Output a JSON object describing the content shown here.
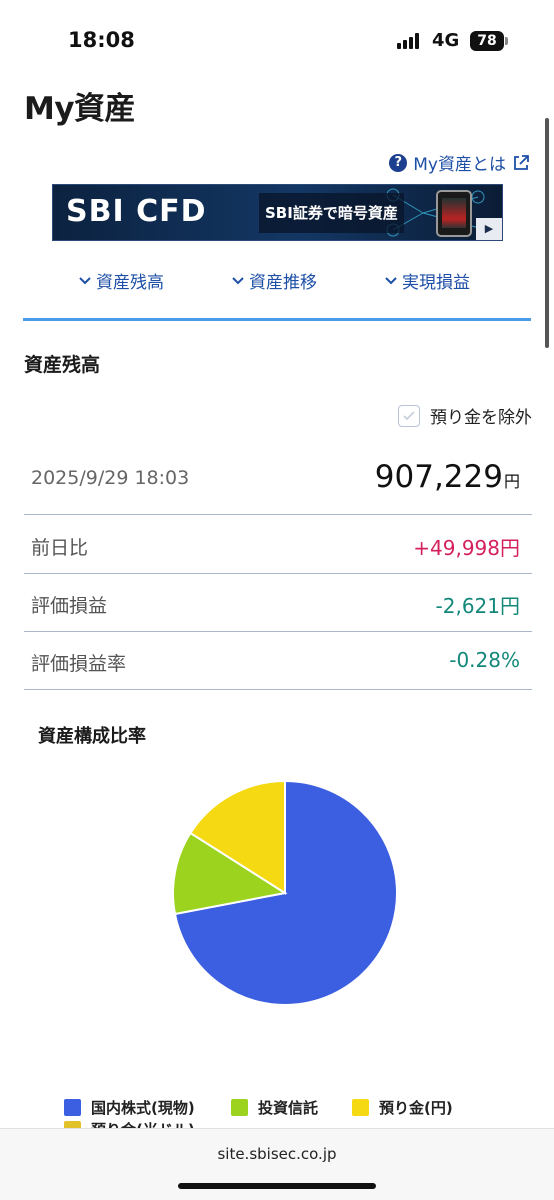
{
  "status_bar": {
    "time": "18:08",
    "network": "4G",
    "battery": "78"
  },
  "page": {
    "title": "My資産",
    "help_link": "My資産とは"
  },
  "banner": {
    "logo": "SBI CFD",
    "text": "SBI証券で暗号資産",
    "play": "▶"
  },
  "anchor_nav": [
    {
      "label": "資産残高"
    },
    {
      "label": "資産推移"
    },
    {
      "label": "実現損益"
    }
  ],
  "balance": {
    "section_title": "資産残高",
    "exclude_label": "預り金を除外",
    "asof": "2025/9/29 18:03",
    "total": "907,229",
    "unit": "円",
    "day_change_label": "前日比",
    "day_change_value": "+49,998円",
    "unrealized_label": "評価損益",
    "unrealized_value": "-2,621円",
    "unrealized_rate_label": "評価損益率",
    "unrealized_rate_value": "-0.28%"
  },
  "composition": {
    "title": "資産構成比率"
  },
  "chart_data": {
    "type": "pie",
    "categories": [
      "国内株式(現物)",
      "投資信託",
      "預り金(円)",
      "預り金(米ドル)"
    ],
    "values": [
      72,
      12,
      16,
      0
    ],
    "colors": [
      "#3b5fe0",
      "#9bd31f",
      "#f5d912",
      "#e1c22b"
    ],
    "legend": "bottom"
  },
  "legend": {
    "items": [
      {
        "label": "国内株式(現物)",
        "color": "#3b5fe0"
      },
      {
        "label": "投資信託",
        "color": "#9bd31f"
      },
      {
        "label": "預り金(円)",
        "color": "#f5d912"
      },
      {
        "label": "預り金(米ドル)",
        "color": "#e1c22b"
      }
    ]
  },
  "browser": {
    "url": "site.sbisec.co.jp"
  }
}
